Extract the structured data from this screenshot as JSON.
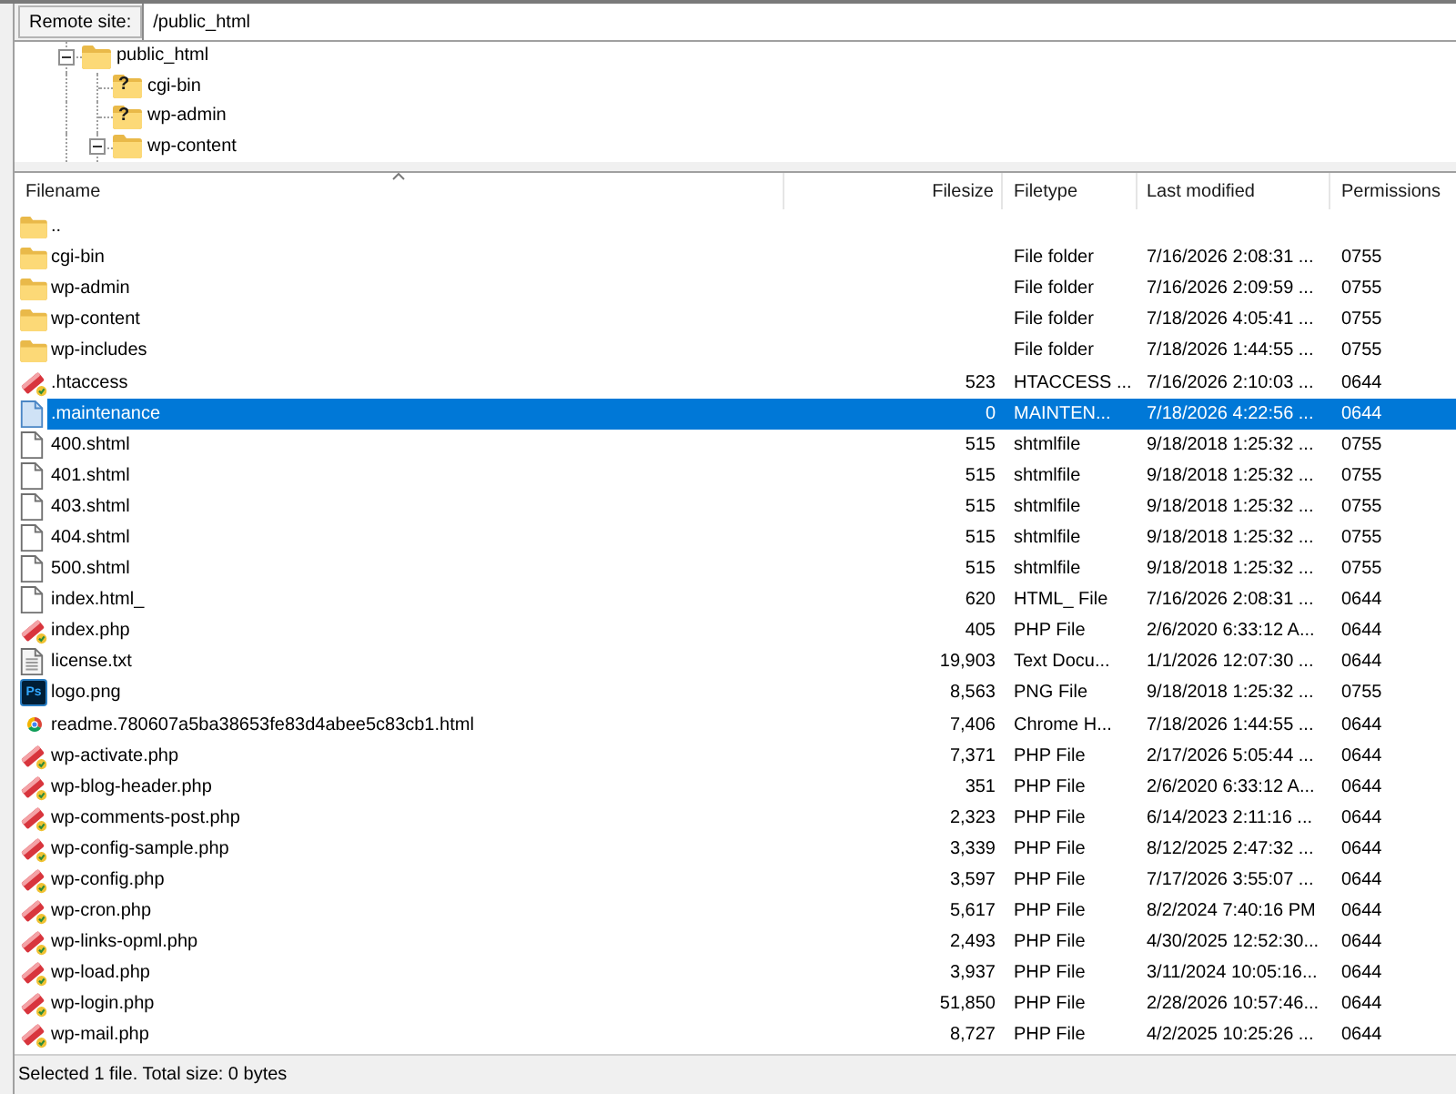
{
  "remote_site": {
    "label": "Remote site:",
    "value": "/public_html"
  },
  "tree": [
    {
      "label": "public_html",
      "expanded": true,
      "children": [
        {
          "label": "cgi-bin",
          "overlay": "?"
        },
        {
          "label": "wp-admin",
          "overlay": "?"
        },
        {
          "label": "wp-content",
          "expanded": true
        }
      ]
    }
  ],
  "columns": [
    {
      "label": "Filename",
      "sorted": true
    },
    {
      "label": "Filesize",
      "sorted": false
    },
    {
      "label": "Filetype",
      "sorted": false
    },
    {
      "label": "Last modified",
      "sorted": false
    },
    {
      "label": "Permissions",
      "sorted": false
    }
  ],
  "rows": [
    {
      "kind": "folder",
      "filename": "..",
      "selected": false
    },
    {
      "kind": "folder",
      "filename": "cgi-bin",
      "filetype": "File folder",
      "last_modified": "7/16/2026 2:08:31 ...",
      "permissions": "0755",
      "selected": false
    },
    {
      "kind": "folder",
      "filename": "wp-admin",
      "filetype": "File folder",
      "last_modified": "7/16/2026 2:09:59 ...",
      "permissions": "0755",
      "selected": false
    },
    {
      "kind": "folder",
      "filename": "wp-content",
      "filetype": "File folder",
      "last_modified": "7/18/2026 4:05:41 ...",
      "permissions": "0755",
      "selected": false
    },
    {
      "kind": "folder",
      "filename": "wp-includes",
      "filetype": "File folder",
      "last_modified": "7/18/2026 1:44:55 ...",
      "permissions": "0755",
      "selected": false
    },
    {
      "kind": "script",
      "filename": ".htaccess",
      "filesize": "523",
      "filetype": "HTACCESS ...",
      "last_modified": "7/16/2026 2:10:03 ...",
      "permissions": "0644",
      "selected": false
    },
    {
      "kind": "file",
      "filename": ".maintenance",
      "filesize": "0",
      "filetype": "MAINTEN...",
      "last_modified": "7/18/2026 4:22:56 ...",
      "permissions": "0644",
      "selected": true
    },
    {
      "kind": "file",
      "filename": "400.shtml",
      "filesize": "515",
      "filetype": "shtmlfile",
      "last_modified": "9/18/2018 1:25:32 ...",
      "permissions": "0755",
      "selected": false
    },
    {
      "kind": "file",
      "filename": "401.shtml",
      "filesize": "515",
      "filetype": "shtmlfile",
      "last_modified": "9/18/2018 1:25:32 ...",
      "permissions": "0755",
      "selected": false
    },
    {
      "kind": "file",
      "filename": "403.shtml",
      "filesize": "515",
      "filetype": "shtmlfile",
      "last_modified": "9/18/2018 1:25:32 ...",
      "permissions": "0755",
      "selected": false
    },
    {
      "kind": "file",
      "filename": "404.shtml",
      "filesize": "515",
      "filetype": "shtmlfile",
      "last_modified": "9/18/2018 1:25:32 ...",
      "permissions": "0755",
      "selected": false
    },
    {
      "kind": "file",
      "filename": "500.shtml",
      "filesize": "515",
      "filetype": "shtmlfile",
      "last_modified": "9/18/2018 1:25:32 ...",
      "permissions": "0755",
      "selected": false
    },
    {
      "kind": "file",
      "filename": "index.html_",
      "filesize": "620",
      "filetype": "HTML_ File",
      "last_modified": "7/16/2026 2:08:31 ...",
      "permissions": "0644",
      "selected": false
    },
    {
      "kind": "script",
      "filename": "index.php",
      "filesize": "405",
      "filetype": "PHP File",
      "last_modified": "2/6/2020 6:33:12 A...",
      "permissions": "0644",
      "selected": false
    },
    {
      "kind": "text",
      "filename": "license.txt",
      "filesize": "19,903",
      "filetype": "Text Docu...",
      "last_modified": "1/1/2026 12:07:30 ...",
      "permissions": "0644",
      "selected": false
    },
    {
      "kind": "image",
      "icon_label": "Ps",
      "filename": "logo.png",
      "filesize": "8,563",
      "filetype": "PNG File",
      "last_modified": "9/18/2018 1:25:32 ...",
      "permissions": "0755",
      "selected": false
    },
    {
      "kind": "browser",
      "filename": "readme.780607a5ba38653fe83d4abee5c83cb1.html",
      "filesize": "7,406",
      "filetype": "Chrome H...",
      "last_modified": "7/18/2026 1:44:55 ...",
      "permissions": "0644",
      "selected": false
    },
    {
      "kind": "script",
      "filename": "wp-activate.php",
      "filesize": "7,371",
      "filetype": "PHP File",
      "last_modified": "2/17/2026 5:05:44 ...",
      "permissions": "0644",
      "selected": false
    },
    {
      "kind": "script",
      "filename": "wp-blog-header.php",
      "filesize": "351",
      "filetype": "PHP File",
      "last_modified": "2/6/2020 6:33:12 A...",
      "permissions": "0644",
      "selected": false
    },
    {
      "kind": "script",
      "filename": "wp-comments-post.php",
      "filesize": "2,323",
      "filetype": "PHP File",
      "last_modified": "6/14/2023 2:11:16 ...",
      "permissions": "0644",
      "selected": false
    },
    {
      "kind": "script",
      "filename": "wp-config-sample.php",
      "filesize": "3,339",
      "filetype": "PHP File",
      "last_modified": "8/12/2025 2:47:32 ...",
      "permissions": "0644",
      "selected": false
    },
    {
      "kind": "script",
      "filename": "wp-config.php",
      "filesize": "3,597",
      "filetype": "PHP File",
      "last_modified": "7/17/2026 3:55:07 ...",
      "permissions": "0644",
      "selected": false
    },
    {
      "kind": "script",
      "filename": "wp-cron.php",
      "filesize": "5,617",
      "filetype": "PHP File",
      "last_modified": "8/2/2024 7:40:16 PM",
      "permissions": "0644",
      "selected": false
    },
    {
      "kind": "script",
      "filename": "wp-links-opml.php",
      "filesize": "2,493",
      "filetype": "PHP File",
      "last_modified": "4/30/2025 12:52:30...",
      "permissions": "0644",
      "selected": false
    },
    {
      "kind": "script",
      "filename": "wp-load.php",
      "filesize": "3,937",
      "filetype": "PHP File",
      "last_modified": "3/11/2024 10:05:16...",
      "permissions": "0644",
      "selected": false
    },
    {
      "kind": "script",
      "filename": "wp-login.php",
      "filesize": "51,850",
      "filetype": "PHP File",
      "last_modified": "2/28/2026 10:57:46...",
      "permissions": "0644",
      "selected": false
    },
    {
      "kind": "script",
      "filename": "wp-mail.php",
      "filesize": "8,727",
      "filetype": "PHP File",
      "last_modified": "4/2/2025 10:25:26 ...",
      "permissions": "0644",
      "selected": false
    }
  ],
  "status_bar": "Selected 1 file. Total size: 0 bytes"
}
